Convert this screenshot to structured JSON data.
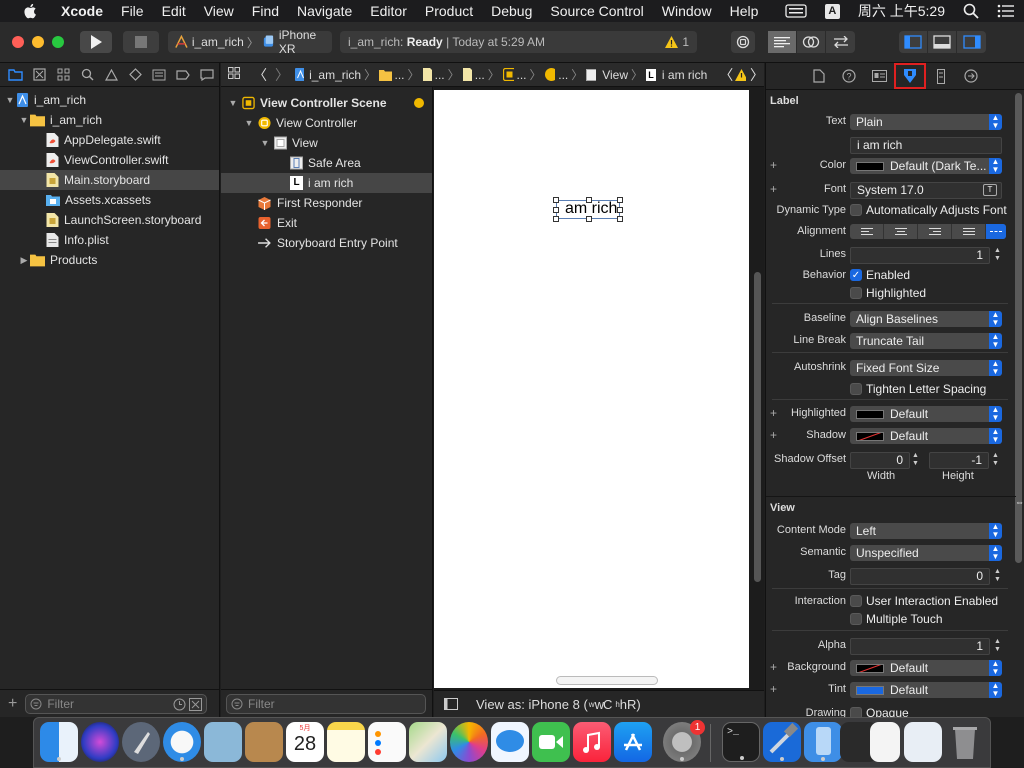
{
  "menubar": {
    "app": "Xcode",
    "items": [
      "File",
      "Edit",
      "View",
      "Find",
      "Navigate",
      "Editor",
      "Product",
      "Debug",
      "Source Control",
      "Window",
      "Help"
    ],
    "input_indicator": "A",
    "clock": "周六 上午5:29"
  },
  "toolbar": {
    "scheme": "i_am_rich",
    "device": "iPhone XR",
    "status_project": "i_am_rich:",
    "status_state": "Ready",
    "status_time": "| Today at 5:29 AM",
    "warning_count": "1"
  },
  "navigator": {
    "project": "i_am_rich",
    "group": "i_am_rich",
    "files": [
      "AppDelegate.swift",
      "ViewController.swift",
      "Main.storyboard",
      "Assets.xcassets",
      "LaunchScreen.storyboard",
      "Info.plist"
    ],
    "products": "Products",
    "filter_placeholder": "Filter"
  },
  "jumpbar": {
    "crumbs": [
      "i_am_rich",
      "...",
      "...",
      "...",
      "...",
      "View",
      "i am rich"
    ]
  },
  "outline": {
    "scene": "View Controller Scene",
    "controller": "View Controller",
    "view": "View",
    "safe_area": "Safe Area",
    "label": "i am rich",
    "first_responder": "First Responder",
    "exit": "Exit",
    "entry": "Storyboard Entry Point",
    "filter_placeholder": "Filter"
  },
  "canvas": {
    "label_text": "am rich",
    "view_as": "View as: iPhone 8 (",
    "view_as_w": "wC",
    "view_as_h": "hR)"
  },
  "inspector": {
    "label_section": "Label",
    "text_label": "Text",
    "text_value": "Plain",
    "text_field": "i am rich",
    "color_label": "Color",
    "color_value": "Default (Dark Te...",
    "font_label": "Font",
    "font_value": "System 17.0",
    "dynamic_label": "Dynamic Type",
    "dynamic_value": "Automatically Adjusts Font",
    "alignment_label": "Alignment",
    "lines_label": "Lines",
    "lines_value": "1",
    "behavior_label": "Behavior",
    "enabled_label": "Enabled",
    "highlighted_label": "Highlighted",
    "baseline_label": "Baseline",
    "baseline_value": "Align Baselines",
    "linebreak_label": "Line Break",
    "linebreak_value": "Truncate Tail",
    "autoshrink_label": "Autoshrink",
    "autoshrink_value": "Fixed Font Size",
    "tighten_label": "Tighten Letter Spacing",
    "hl_color_label": "Highlighted",
    "hl_color_value": "Default",
    "shadow_label": "Shadow",
    "shadow_value": "Default",
    "shadow_offset_label": "Shadow Offset",
    "shadow_w": "0",
    "shadow_h": "-1",
    "width_label": "Width",
    "height_label": "Height",
    "view_section": "View",
    "content_mode_label": "Content Mode",
    "content_mode_value": "Left",
    "semantic_label": "Semantic",
    "semantic_value": "Unspecified",
    "tag_label": "Tag",
    "tag_value": "0",
    "interaction_label": "Interaction",
    "user_interaction": "User Interaction Enabled",
    "multiple_touch": "Multiple Touch",
    "alpha_label": "Alpha",
    "alpha_value": "1",
    "background_label": "Background",
    "background_value": "Default",
    "tint_label": "Tint",
    "tint_value": "Default",
    "drawing_label": "Drawing",
    "drawing_value": "Opaque"
  },
  "dock": {
    "calendar_month": "5月",
    "calendar_day": "28",
    "appstore_badge": "1"
  },
  "colors": {
    "accent": "#1a68e0",
    "highlight_box": "#e02020"
  }
}
